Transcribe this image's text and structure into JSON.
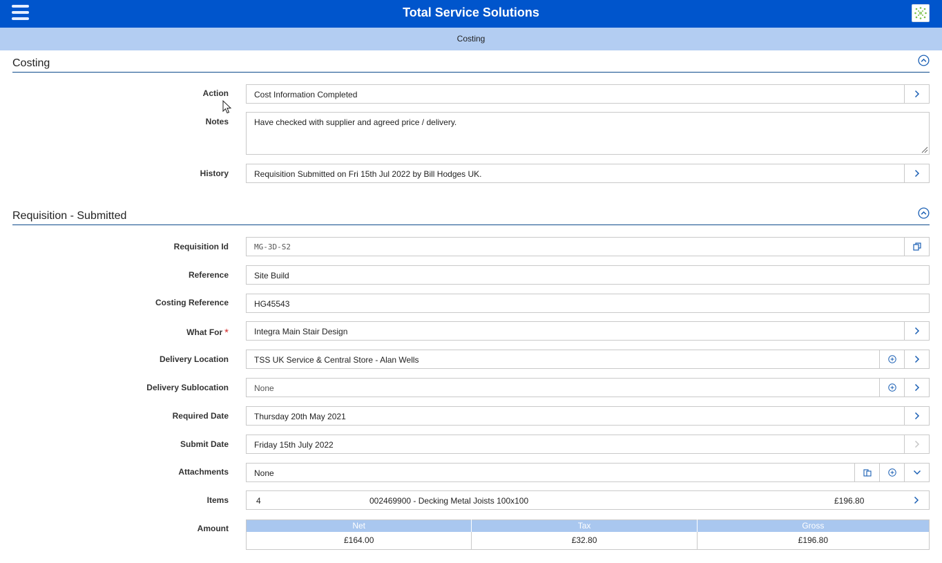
{
  "app": {
    "title": "Total Service Solutions",
    "subtitle": "Costing"
  },
  "colors": {
    "topbar": "#0055cc",
    "subbar": "#b3cdf2",
    "accent": "#1a5fb4",
    "required": "#d32f2f"
  },
  "costing": {
    "title": "Costing",
    "action": {
      "label": "Action",
      "value": "Cost Information Completed"
    },
    "notes": {
      "label": "Notes",
      "value": "Have checked with supplier and agreed price / delivery."
    },
    "history": {
      "label": "History",
      "value": "Requisition Submitted on Fri 15th Jul 2022 by Bill Hodges UK."
    }
  },
  "requisition": {
    "title": "Requisition - Submitted",
    "requisition_id": {
      "label": "Requisition Id",
      "value": "MG-3D-S2"
    },
    "reference": {
      "label": "Reference",
      "value": "Site Build"
    },
    "costing_reference": {
      "label": "Costing Reference",
      "value": "HG45543"
    },
    "what_for": {
      "label": "What For",
      "required_mark": "*",
      "value": "Integra Main Stair Design"
    },
    "delivery_location": {
      "label": "Delivery Location",
      "value": "TSS UK Service & Central Store - Alan Wells"
    },
    "delivery_sublocation": {
      "label": "Delivery Sublocation",
      "value": "None"
    },
    "required_date": {
      "label": "Required Date",
      "value": "Thursday 20th May 2021"
    },
    "submit_date": {
      "label": "Submit Date",
      "value": "Friday 15th July 2022"
    },
    "attachments": {
      "label": "Attachments",
      "value": "None"
    },
    "items": {
      "label": "Items",
      "qty": "4",
      "description": "002469900 - Decking Metal Joists 100x100",
      "price": "£196.80"
    },
    "amount": {
      "label": "Amount",
      "headers": [
        "Net",
        "Tax",
        "Gross"
      ],
      "values": [
        "£164.00",
        "£32.80",
        "£196.80"
      ]
    }
  },
  "icons": [
    "menu-icon",
    "app-logo-icon",
    "collapse-up-icon",
    "chevron-right-icon",
    "copy-icon",
    "plus-circle-icon",
    "chevron-down-icon",
    "resize-grip-icon",
    "mouse-cursor-icon"
  ]
}
